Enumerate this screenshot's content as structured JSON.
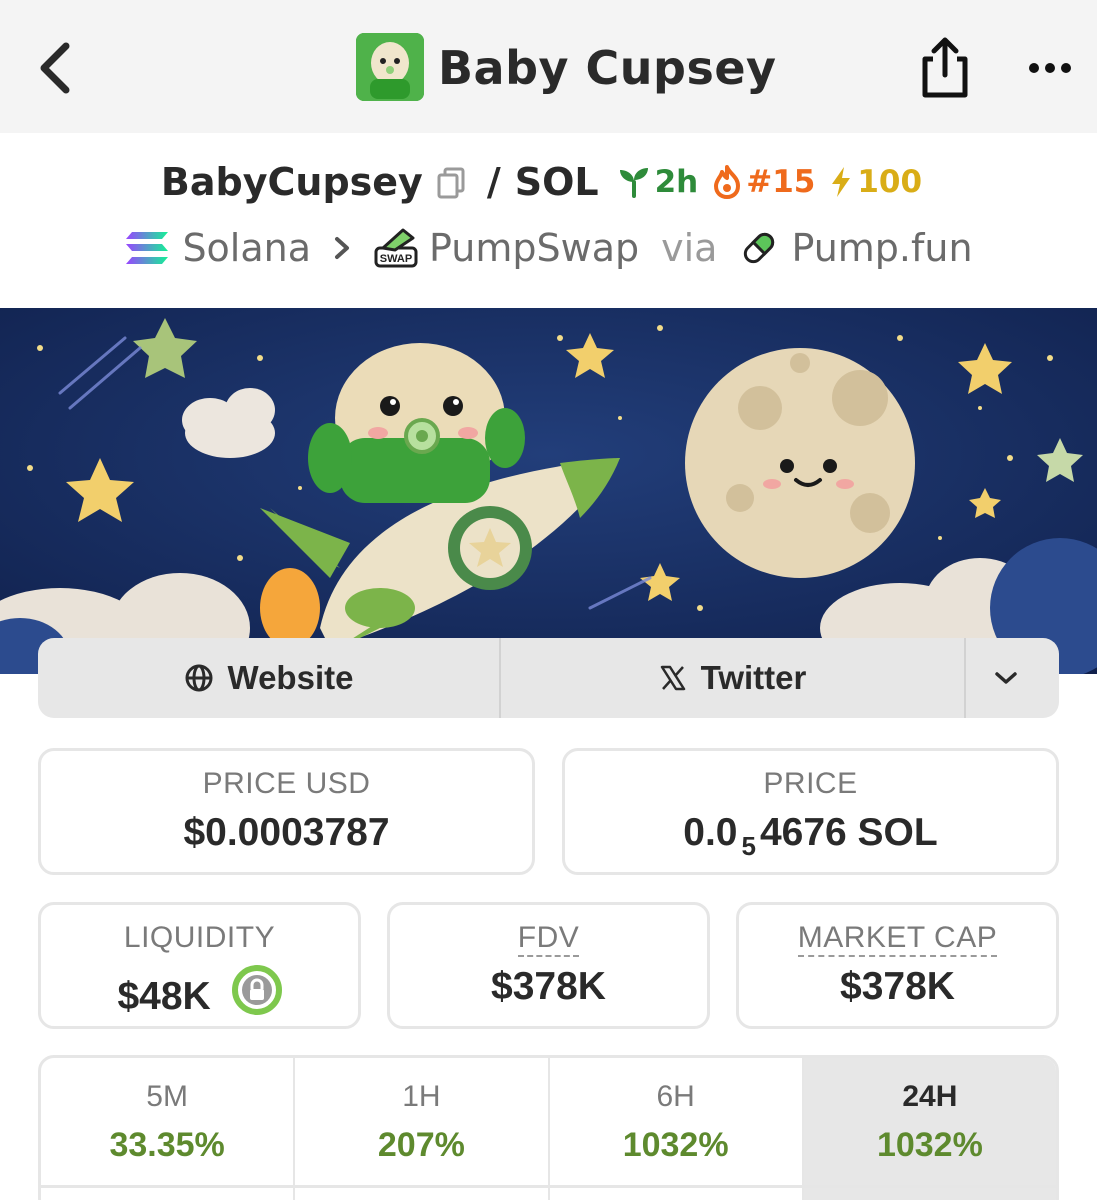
{
  "header": {
    "title": "Baby Cupsey"
  },
  "pair": {
    "token": "BabyCupsey",
    "separator": "/",
    "quote": "SOL",
    "age": "2h",
    "rank": "#15",
    "boost": "100"
  },
  "chain": {
    "network": "Solana",
    "arrow": ">",
    "dex": "PumpSwap",
    "via": "via",
    "launchpad": "Pump.fun"
  },
  "links": {
    "website": "Website",
    "twitter": "Twitter"
  },
  "stats": {
    "price_usd_label": "PRICE USD",
    "price_usd": "$0.0003787",
    "price_label": "PRICE",
    "price_prefix": "0.0",
    "price_subscript": "5",
    "price_suffix": "4676 SOL",
    "liquidity_label": "LIQUIDITY",
    "liquidity": "$48K",
    "fdv_label": "FDV",
    "fdv": "$378K",
    "mcap_label": "MARKET CAP",
    "mcap": "$378K"
  },
  "timeframes": [
    {
      "label": "5M",
      "value": "33.35%"
    },
    {
      "label": "1H",
      "value": "207%"
    },
    {
      "label": "6H",
      "value": "1032%"
    },
    {
      "label": "24H",
      "value": "1032%"
    }
  ],
  "colors": {
    "positive": "#5e8a2e",
    "age_badge": "#2e8b3a",
    "rank_badge": "#ef6a1c",
    "boost_badge": "#d9ad17"
  }
}
